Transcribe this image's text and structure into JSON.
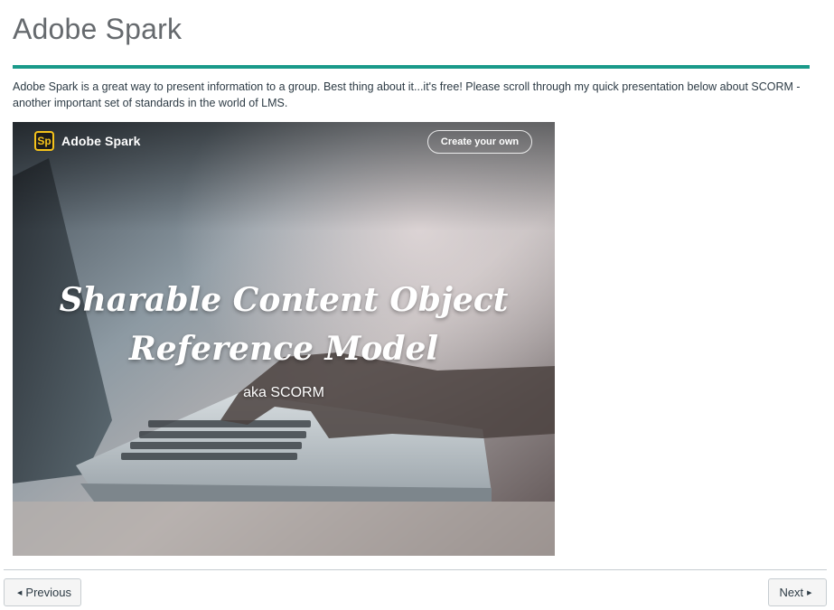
{
  "page": {
    "title": "Adobe Spark",
    "intro": "Adobe Spark is a great way to present information to a group. Best thing about it...it's free! Please scroll through my quick presentation below about SCORM - another important set of standards in the world of LMS.",
    "accent_color": "#1a9a8a"
  },
  "embed": {
    "brand_logo_text": "Sp",
    "brand_label": "Adobe Spark",
    "create_label": "Create your own",
    "headline_line1": "Sharable Content Object",
    "headline_line2": "Reference Model",
    "subline": "aka SCORM",
    "logo_color": "#f4c21b"
  },
  "footer": {
    "previous_label": "Previous",
    "next_label": "Next",
    "previous_icon": "triangle-left-icon",
    "next_icon": "triangle-right-icon"
  }
}
